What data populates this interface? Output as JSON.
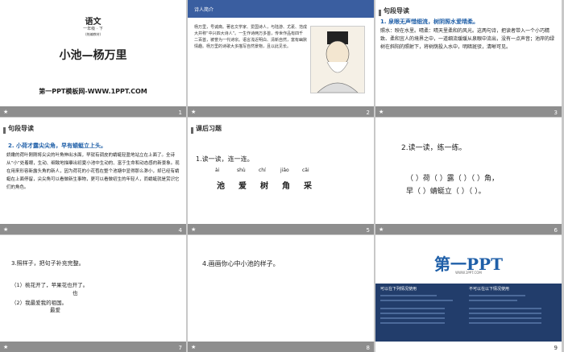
{
  "slides": [
    {
      "number": "1",
      "subject": "语文",
      "grade": "一年级 · 下",
      "grade_sub": "(统编教材)",
      "title": "小池—杨万里",
      "website": "第一PPT模板网-WWW.1PPT.COM"
    },
    {
      "number": "2",
      "tag": "诗人简介",
      "text": "杨万里，号诚斋。著名文学家、爱国诗人，与陆游、尤袤、范成大并称“中兴四大诗人”。一生作诗两万多首，传世作品有四千二百首，被誉为一代诗宗。语言浅近明白、清新自然，富有幽默情趣。杨万里的诗歌大多描写自然景物，且以此见长。"
    },
    {
      "number": "3",
      "tag": "句段导读",
      "heading": "1. 泉眼无声惜细流，树阴照水爱晴柔。",
      "body": "照水：映在水里。晴柔：晴天里柔和的风光。这两句诗，把读者带入一个小巧精致、柔和宜人的境界之中，一道细流缓缓从泉眼中流出，没有一点声音；池岸的绿树在斜阳的照射下，将树荫投入水中，明暗斑驳，清晰可见。"
    },
    {
      "number": "4",
      "tag": "句段导读",
      "heading": "2. 小荷才露尖尖角，早有蜻蜓立上头。",
      "body": "娇嫩的荷叶刚刚将尖尖的叶角伸出水面，早就有调皮的蜻蜓轻盈地站立在上面了。全诗从“小”处着眼，生动、细致地描摹出初夏小池中生动的、富于生命和动态感的新景象。现在用来形容新露头角的新人，因为荷花的小花苞在整个池塘中显得那么渺小，却已经有蜻蜓在上面停留，尖尖角可以看做新生事物，更可以看做初生的年轻人，而蜻蜓就是赏识它们的角色。"
    },
    {
      "number": "5",
      "tag": "课后习题",
      "line1": "1.读一读，连一连。",
      "pinyin": [
        "ài",
        "shù",
        "chí",
        "jiǎo",
        "cǎi"
      ],
      "hanzi": [
        "池",
        "爱",
        "树",
        "角",
        "采"
      ]
    },
    {
      "number": "6",
      "line1": "2.读一读，练一练。",
      "row1": "（ ）荷（ ）露（ ）（ ）角，",
      "row2": "早（ ）蜻蜓立（ ）（ ）。"
    },
    {
      "number": "7",
      "line1": "3.照样子，把句子补充完整。",
      "row1": "（1）桃花开了，苹果花也开了。",
      "row1b": "也",
      "row2": "（2）我最爱我的祖国。",
      "row2b": "最爱"
    },
    {
      "number": "8",
      "line1": "4.画画你心中小池的样子。"
    },
    {
      "number": "9",
      "logo": "第一PPT",
      "url": "WWW.1PPT.COM",
      "left_title": "可以在下列情况使用",
      "right_title": "不可以在以下情况使用"
    }
  ],
  "footer_marker": "ж"
}
